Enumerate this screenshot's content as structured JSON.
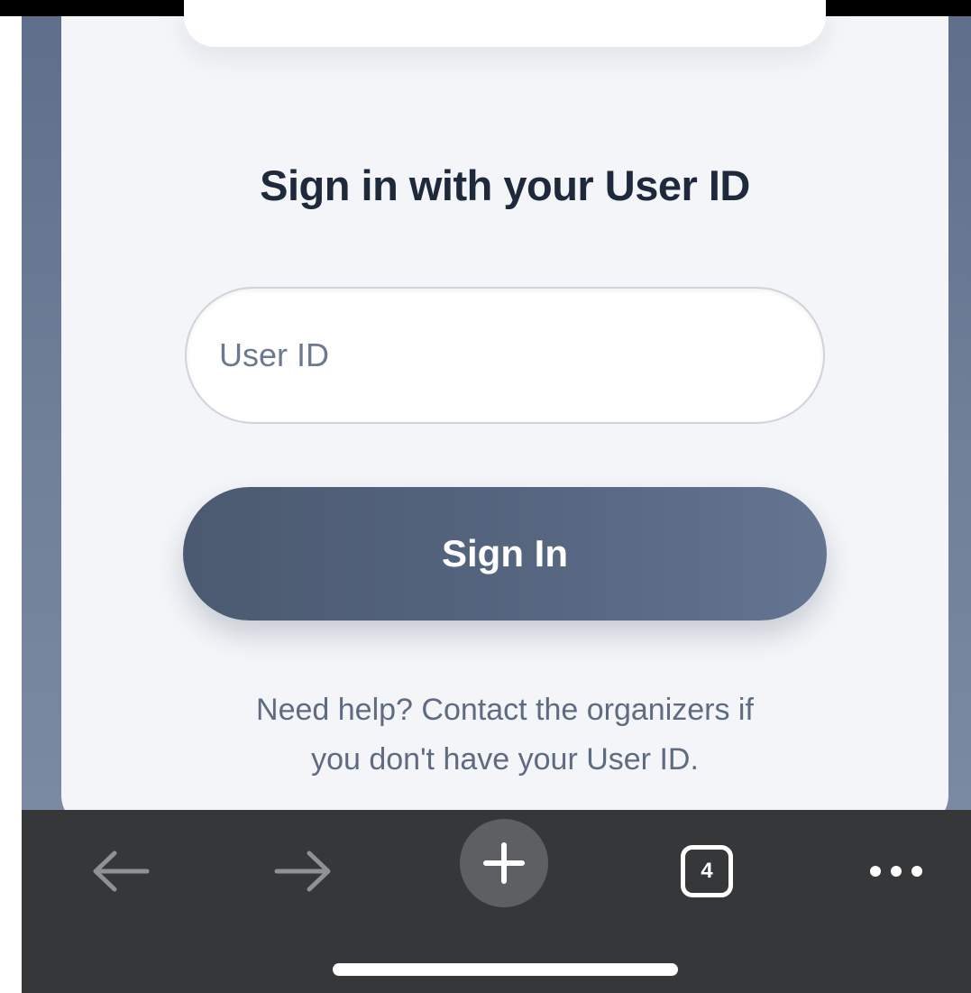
{
  "login": {
    "title": "Sign in with your User ID",
    "user_id_placeholder": "User ID",
    "user_id_value": "",
    "sign_in_label": "Sign In",
    "help_line_1": "Need help? Contact the organizers if",
    "help_line_2": "you don't have your User ID."
  },
  "toolbar": {
    "back_icon": "arrow-left-icon",
    "forward_icon": "arrow-right-icon",
    "new_tab_icon": "plus-icon",
    "tab_count": "4",
    "more_icon": "ellipsis-icon"
  },
  "colors": {
    "heading": "#1e293b",
    "button": "#566680",
    "toolbar": "#353739",
    "help_text": "#5e6b80"
  }
}
